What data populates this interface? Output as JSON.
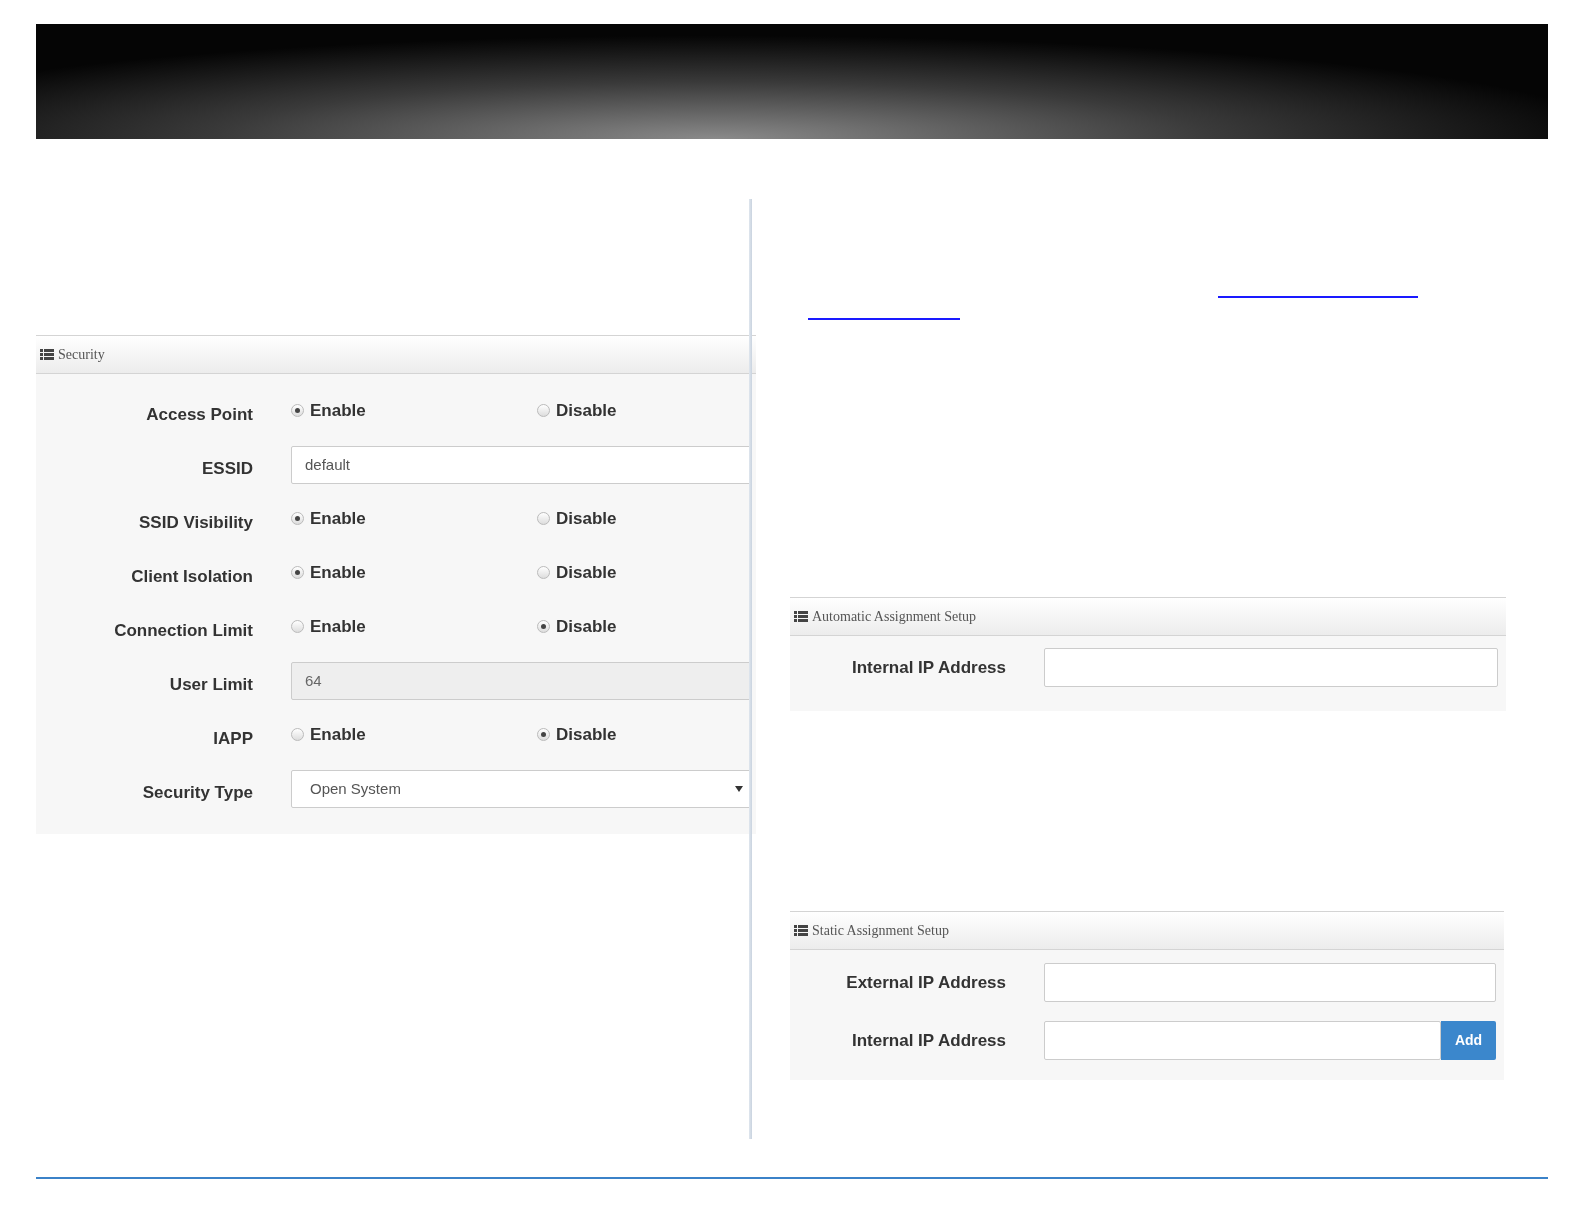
{
  "security": {
    "title": "Security",
    "rows": [
      {
        "kind": "radio",
        "label": "Access Point",
        "options": [
          {
            "label": "Enable",
            "selected": true
          },
          {
            "label": "Disable",
            "selected": false
          }
        ]
      },
      {
        "kind": "text",
        "label": "ESSID",
        "value": "default",
        "disabled": false
      },
      {
        "kind": "radio",
        "label": "SSID Visibility",
        "options": [
          {
            "label": "Enable",
            "selected": true
          },
          {
            "label": "Disable",
            "selected": false
          }
        ]
      },
      {
        "kind": "radio",
        "label": "Client Isolation",
        "options": [
          {
            "label": "Enable",
            "selected": true
          },
          {
            "label": "Disable",
            "selected": false
          }
        ]
      },
      {
        "kind": "radio",
        "label": "Connection Limit",
        "options": [
          {
            "label": "Enable",
            "selected": false
          },
          {
            "label": "Disable",
            "selected": true
          }
        ]
      },
      {
        "kind": "text",
        "label": "User Limit",
        "value": "64",
        "disabled": true
      },
      {
        "kind": "radio",
        "label": "IAPP",
        "options": [
          {
            "label": "Enable",
            "selected": false
          },
          {
            "label": "Disable",
            "selected": true
          }
        ]
      },
      {
        "kind": "select",
        "label": "Security Type",
        "value": "Open System"
      }
    ]
  },
  "automatic_assignment": {
    "title": "Automatic Assignment Setup",
    "rows": [
      {
        "label": "Internal IP Address"
      }
    ]
  },
  "static_assignment": {
    "title": "Static Assignment Setup",
    "rows": [
      {
        "label": "External IP Address"
      },
      {
        "label": "Internal IP Address",
        "button": "Add"
      }
    ]
  }
}
